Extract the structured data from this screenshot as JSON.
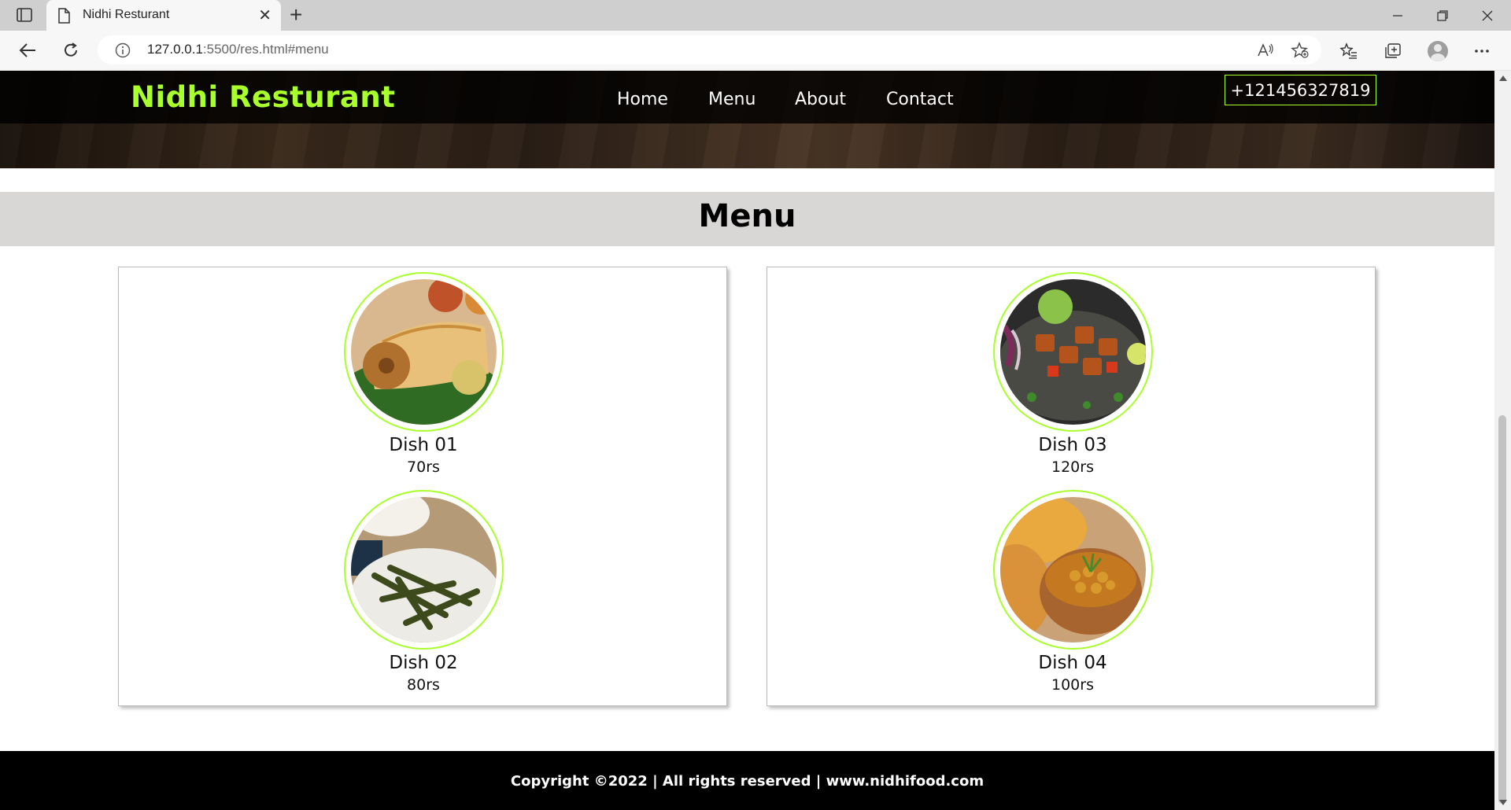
{
  "browser": {
    "tab_title": "Nidhi Resturant",
    "url_host": "127.0.0.1",
    "url_rest": ":5500/res.html#menu"
  },
  "site": {
    "logo": "Nidhi Resturant",
    "nav": [
      "Home",
      "Menu",
      "About",
      "Contact"
    ],
    "phone": "+121456327819",
    "menu_title": "Menu",
    "dishes": [
      {
        "name": "Dish 01",
        "price": "70rs"
      },
      {
        "name": "Dish 02",
        "price": "80rs"
      },
      {
        "name": "Dish 03",
        "price": "120rs"
      },
      {
        "name": "Dish 04",
        "price": "100rs"
      }
    ],
    "footer": "Copyright ©2022 | All rights reserved | www.nidhifood.com"
  },
  "colors": {
    "accent": "#a8ff2b",
    "menu_band": "#d9d6d6",
    "footer_bg": "#000000"
  }
}
